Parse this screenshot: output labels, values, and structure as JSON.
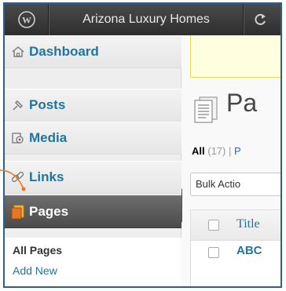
{
  "adminbar": {
    "logo_icon": "wordpress-logo-icon",
    "site_name": "Arizona Luxury Homes",
    "refresh_icon": "refresh-icon"
  },
  "sidebar": {
    "items": [
      {
        "label": "Dashboard",
        "icon": "home-icon"
      },
      {
        "label": "Posts",
        "icon": "pushpin-icon"
      },
      {
        "label": "Media",
        "icon": "media-icon"
      },
      {
        "label": "Links",
        "icon": "link-icon"
      },
      {
        "label": "Pages",
        "icon": "pages-icon",
        "current": true
      }
    ],
    "submenu": {
      "active": "All Pages",
      "link": "Add New"
    }
  },
  "main": {
    "title": "Pa",
    "filters": {
      "all_label": "All",
      "all_count": "(17)",
      "separator": "|",
      "next_fragment": "P"
    },
    "bulk_actions": "Bulk Actio",
    "table": {
      "column_title": "Title",
      "first_row_title": "ABC"
    }
  },
  "colors": {
    "link": "#21759b",
    "adminbar": "#3a3a3a",
    "current_menu": "#5c5c5c",
    "notice": "#ffffe0",
    "frame_border": "#2a5f93",
    "callout": "#e87722"
  }
}
